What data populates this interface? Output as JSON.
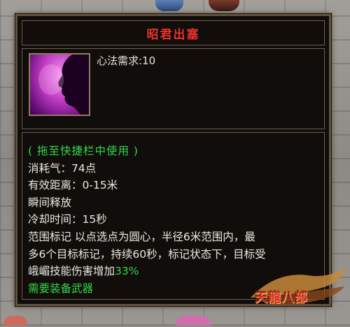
{
  "tooltip": {
    "title": "昭君出塞",
    "requirement": "心法需求:10",
    "hint": "( 拖至快捷栏中使用 )",
    "stats": [
      "消耗气：74点",
      "有效距离：0-15米",
      "瞬间释放",
      "冷却时间：15秒"
    ],
    "description": [
      "范围标记 以点选点为圆心，半径6米范围内，最",
      "多6个目标标记，持续60秒，标记状态下，目标受"
    ],
    "last_line_prefix": "峨嵋技能伤害增加",
    "bonus_value": "33%",
    "weapon_req": "需要装备武器"
  },
  "logo": {
    "text": "天龍八部"
  },
  "colors": {
    "title": "#e8322a",
    "green": "#35d84a",
    "text": "#ece8e0",
    "border": "#6f614e",
    "panel": "#100d0b"
  },
  "icons": {
    "skill": "silhouette-face-icon"
  }
}
